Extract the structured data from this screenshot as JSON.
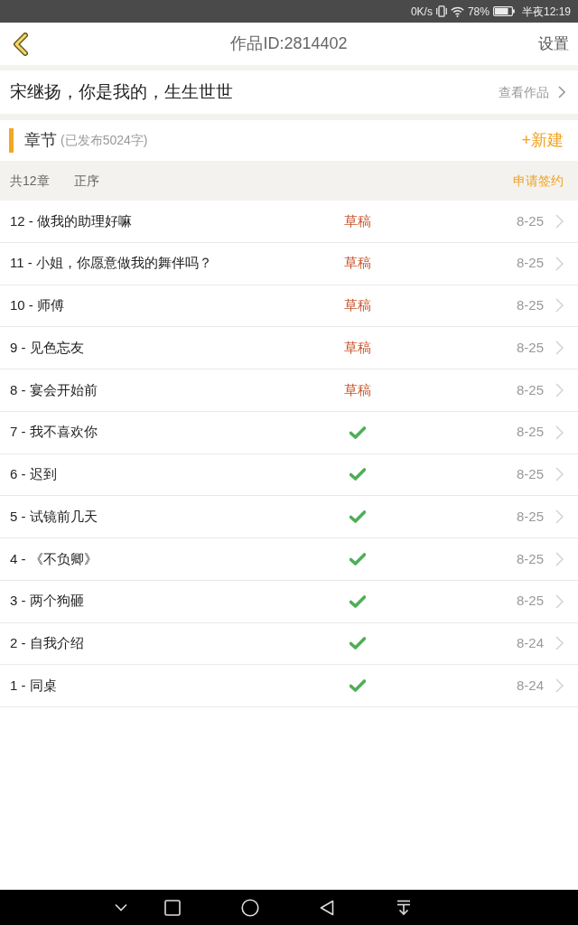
{
  "status_bar": {
    "network_speed": "0K/s",
    "battery": "78%",
    "time": "半夜12:19"
  },
  "header": {
    "title": "作品ID:2814402",
    "action": "设置"
  },
  "work": {
    "title": "宋继扬，你是我的，生生世世",
    "link": "查看作品"
  },
  "section": {
    "title": "章节",
    "subtitle": "(已发布5024字)",
    "action": "+新建"
  },
  "toolbar": {
    "count": "共12章",
    "sort": "正序",
    "action": "申请签约"
  },
  "chapters": [
    {
      "title": "12 - 做我的助理好嘛",
      "kind": "draft",
      "status": "草稿",
      "date": "8-25"
    },
    {
      "title": "11 - 小姐，你愿意做我的舞伴吗？",
      "kind": "draft",
      "status": "草稿",
      "date": "8-25"
    },
    {
      "title": "10 - 师傅",
      "kind": "draft",
      "status": "草稿",
      "date": "8-25"
    },
    {
      "title": "9 - 见色忘友",
      "kind": "draft",
      "status": "草稿",
      "date": "8-25"
    },
    {
      "title": "8 - 宴会开始前",
      "kind": "draft",
      "status": "草稿",
      "date": "8-25"
    },
    {
      "title": "7 - 我不喜欢你",
      "kind": "published",
      "date": "8-25"
    },
    {
      "title": "6 - 迟到",
      "kind": "published",
      "date": "8-25"
    },
    {
      "title": "5 - 试镜前几天",
      "kind": "published",
      "date": "8-25"
    },
    {
      "title": "4 - 《不负卿》",
      "kind": "published",
      "date": "8-25"
    },
    {
      "title": "3 - 两个狗砸",
      "kind": "published",
      "date": "8-25"
    },
    {
      "title": "2 - 自我介绍",
      "kind": "published",
      "date": "8-24"
    },
    {
      "title": "1 - 同桌",
      "kind": "published",
      "date": "8-24"
    }
  ]
}
